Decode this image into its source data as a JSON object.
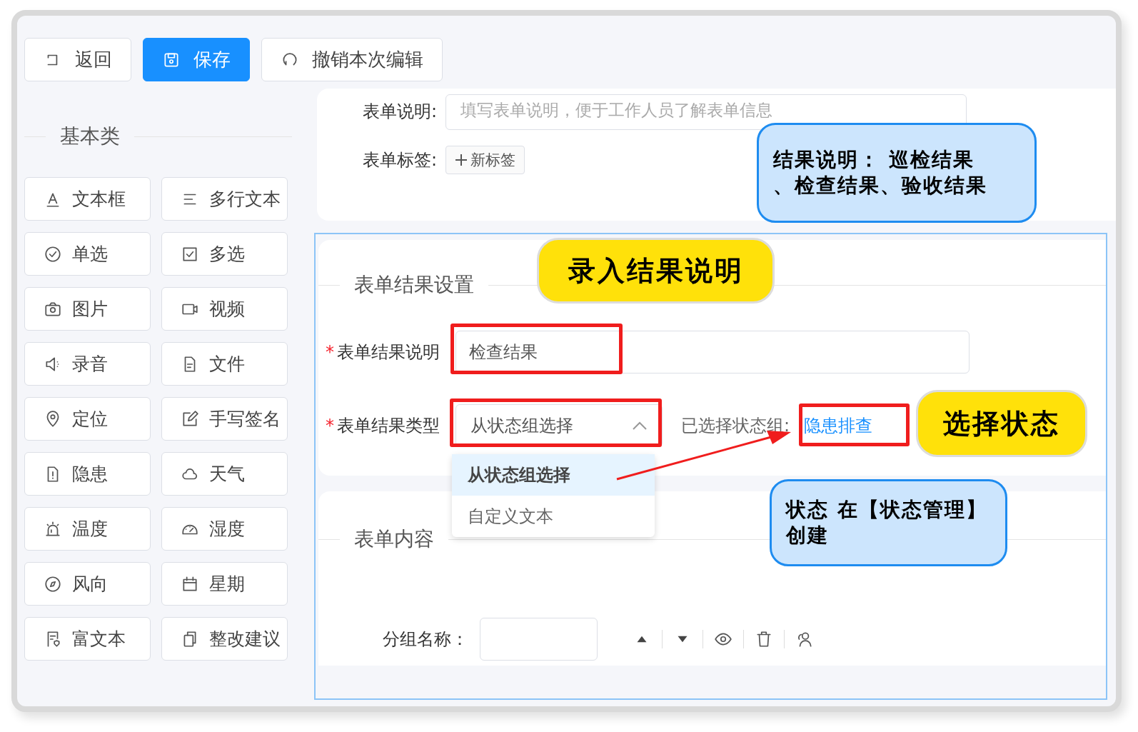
{
  "toolbar": [
    {
      "label": "返回",
      "kind": "back",
      "primary": false
    },
    {
      "label": "保存",
      "kind": "save",
      "primary": true
    },
    {
      "label": "撤销本次编辑",
      "kind": "undo",
      "primary": false
    }
  ],
  "sidebar": {
    "title": "基本类",
    "items": [
      {
        "label": "文本框",
        "kind": "text"
      },
      {
        "label": "多行文本",
        "kind": "lines"
      },
      {
        "label": "单选",
        "kind": "radio"
      },
      {
        "label": "多选",
        "kind": "checkbox"
      },
      {
        "label": "图片",
        "kind": "camera"
      },
      {
        "label": "视频",
        "kind": "video"
      },
      {
        "label": "录音",
        "kind": "speaker"
      },
      {
        "label": "文件",
        "kind": "file"
      },
      {
        "label": "定位",
        "kind": "pin"
      },
      {
        "label": "手写签名",
        "kind": "edit"
      },
      {
        "label": "隐患",
        "kind": "alert"
      },
      {
        "label": "天气",
        "kind": "cloud"
      },
      {
        "label": "温度",
        "kind": "alarm"
      },
      {
        "label": "湿度",
        "kind": "gauge"
      },
      {
        "label": "风向",
        "kind": "compass"
      },
      {
        "label": "星期",
        "kind": "calendar"
      },
      {
        "label": "富文本",
        "kind": "richtext"
      },
      {
        "label": "整改建议",
        "kind": "copy"
      }
    ]
  },
  "form_info": {
    "description": {
      "label": "表单说明:",
      "placeholder": "填写表单说明，便于工作人员了解表单信息"
    },
    "tags": {
      "label": "表单标签:",
      "button": "新标签"
    }
  },
  "result_settings": {
    "title": "表单结果设置",
    "description": {
      "required_mark": "*",
      "label": "表单结果说明",
      "value": "检查结果"
    },
    "type": {
      "required_mark": "*",
      "label": "表单结果类型",
      "value": "从状态组选择",
      "expanded": true,
      "selected_group_label": "已选择状态组:",
      "selected_group": "隐患排查"
    },
    "options": [
      {
        "label": "从状态组选择",
        "selected": true
      },
      {
        "label": "自定义文本",
        "selected": false
      }
    ]
  },
  "content_settings": {
    "title": "表单内容",
    "group": {
      "label": "分组名称："
    }
  },
  "annotations": {
    "callouts": [
      {
        "text": "结果说明： 巡检结果、检查结果、验收结果",
        "kind": "blue"
      },
      {
        "text": "录入结果说明",
        "kind": "yellow"
      },
      {
        "text": "选择状态",
        "kind": "yellow"
      },
      {
        "text": "状态 在【状态管理】创建",
        "kind": "blue"
      }
    ]
  }
}
